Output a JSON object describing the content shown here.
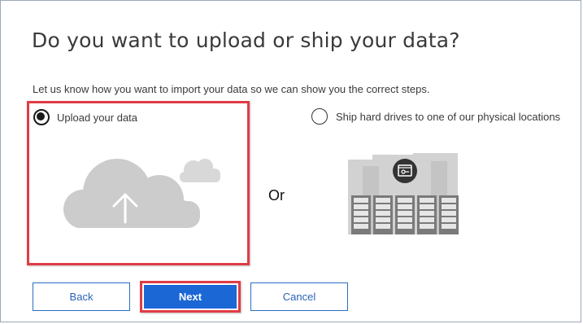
{
  "dialog": {
    "title": "Do you want to upload or ship your data?",
    "subtitle": "Let us know how you want to import your data so we can show you the correct steps."
  },
  "options": {
    "upload": {
      "label": "Upload your data",
      "selected": true,
      "icon": "cloud-upload-icon"
    },
    "separator": "Or",
    "ship": {
      "label": "Ship hard drives to one of our physical locations",
      "selected": false,
      "icon": "datacenter-icon"
    }
  },
  "buttons": {
    "back_label": "Back",
    "next_label": "Next",
    "cancel_label": "Cancel"
  },
  "colors": {
    "highlight": "#e03c46",
    "primary": "#1b67d6",
    "secondary_text": "#2a63b8",
    "icon_gray": "#cdcdcd"
  }
}
